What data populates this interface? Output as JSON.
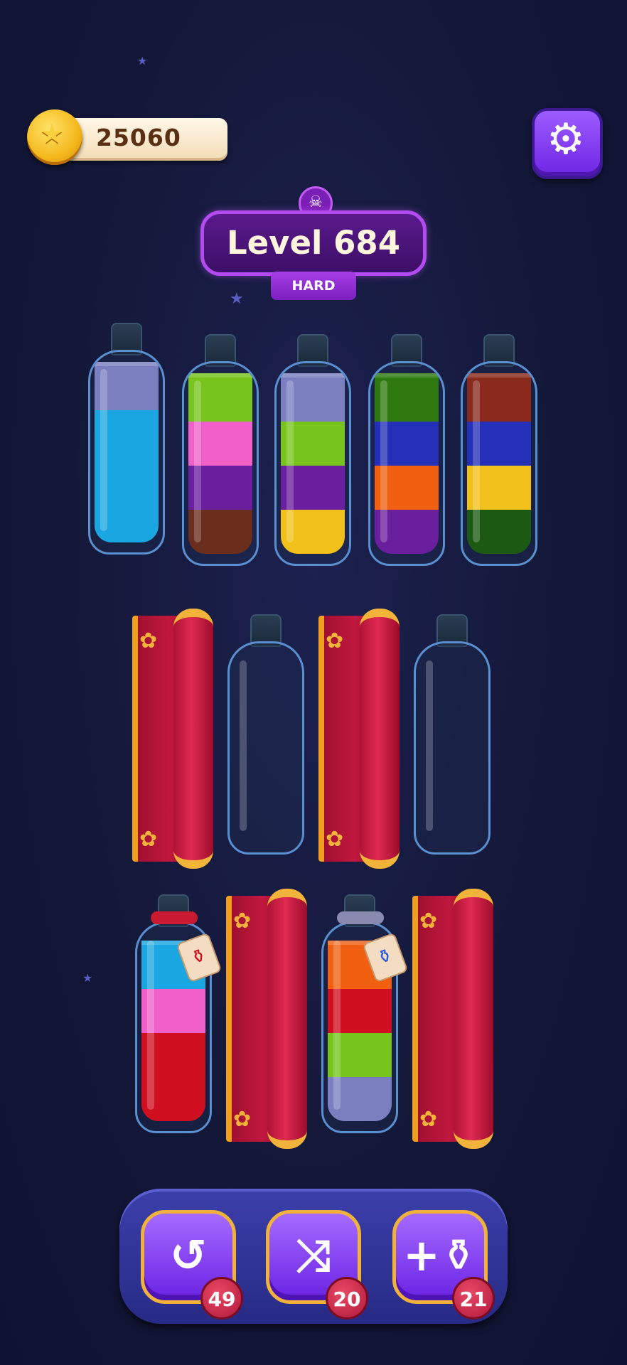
{
  "hud": {
    "coins": "25060",
    "settings_icon": "gear-icon"
  },
  "level": {
    "title": "Level 684",
    "difficulty": "HARD",
    "difficulty_icon": "skull-icon"
  },
  "colors": {
    "lavender": "#7c7fbf",
    "sky": "#1aa6e0",
    "lime": "#76c41c",
    "pink": "#f060c8",
    "purple": "#6a1f9e",
    "brown": "#6a2e1c",
    "yellow": "#f2c01a",
    "green": "#2e7a10",
    "blue": "#2430b8",
    "orange": "#f06010",
    "rust": "#8a2a1c",
    "dkgreen": "#1c5a14",
    "red": "#d01020"
  },
  "rows": {
    "top_bottles": [
      {
        "layers": [
          "lavender",
          "sky",
          "sky",
          "sky"
        ]
      },
      {
        "layers": [
          "lime",
          "pink",
          "purple",
          "brown"
        ]
      },
      {
        "layers": [
          "lavender",
          "lime",
          "purple",
          "yellow"
        ]
      },
      {
        "layers": [
          "green",
          "blue",
          "orange",
          "purple"
        ]
      },
      {
        "layers": [
          "rust",
          "blue",
          "yellow",
          "dkgreen"
        ]
      }
    ],
    "middle": [
      "curtain",
      "empty-bottle",
      "curtain",
      "empty-bottle"
    ],
    "bottom": [
      "locked-bottle-red-tag",
      "curtain",
      "locked-bottle-blue-tag",
      "curtain"
    ],
    "locked_bottle_1": [
      "sky",
      "pink",
      "red",
      "red"
    ],
    "locked_bottle_2": [
      "orange",
      "red",
      "lime",
      "lavender"
    ]
  },
  "tools": {
    "undo": {
      "icon": "undo-icon",
      "count": "49"
    },
    "shuffle": {
      "icon": "shuffle-icon",
      "count": "20"
    },
    "add_bottle": {
      "icon": "add-bottle-icon",
      "count": "21"
    }
  }
}
